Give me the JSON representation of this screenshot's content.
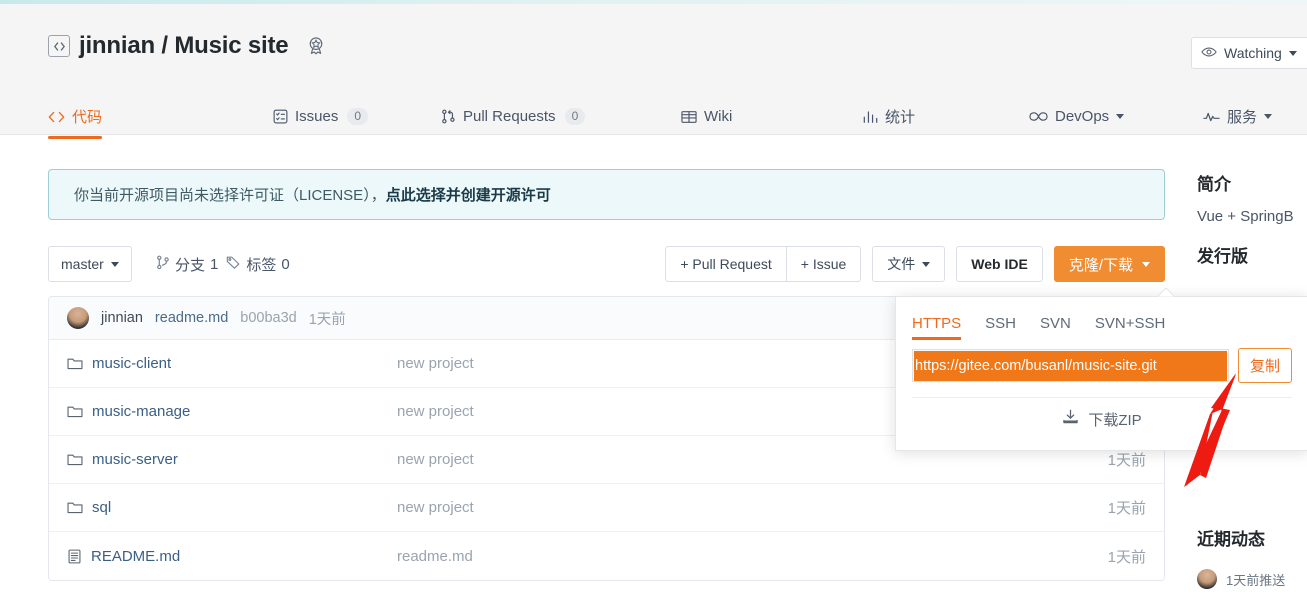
{
  "header": {
    "owner": "jinnian",
    "separator": "/",
    "repo": "Music site",
    "repo_icon": "code-repo-icon",
    "badge_icon": "award-badge-icon",
    "watching": {
      "label": "Watching",
      "icon": "eye-icon"
    }
  },
  "nav": {
    "tabs": [
      {
        "label": "代码",
        "icon": "code-icon",
        "count": null,
        "active": true
      },
      {
        "label": "Issues",
        "icon": "issues-icon",
        "count": "0",
        "active": false
      },
      {
        "label": "Pull Requests",
        "icon": "pull-request-icon",
        "count": "0",
        "active": false
      },
      {
        "label": "Wiki",
        "icon": "wiki-book-icon",
        "count": null,
        "active": false
      },
      {
        "label": "统计",
        "icon": "chart-bar-icon",
        "count": null,
        "active": false
      },
      {
        "label": "DevOps",
        "icon": "infinity-icon",
        "count": null,
        "active": false,
        "dropdown": true
      },
      {
        "label": "服务",
        "icon": "pulse-icon",
        "count": null,
        "active": false,
        "dropdown": true
      }
    ]
  },
  "license_banner": {
    "text": "你当前开源项目尚未选择许可证（LICENSE），",
    "link": "点此选择并创建开源许可"
  },
  "toolbar": {
    "branch": "master",
    "branches_label": "分支",
    "branches_count": "1",
    "tags_label": "标签",
    "tags_count": "0",
    "pull_request": "+ Pull Request",
    "issue": "+ Issue",
    "file_menu": "文件",
    "web_ide": "Web IDE",
    "clone_download": "克隆/下载"
  },
  "commit_header": {
    "author": "jinnian",
    "message": "readme.md",
    "sha": "b00ba3d",
    "time": "1天前"
  },
  "files": [
    {
      "name": "music-client",
      "type": "folder",
      "commit": "new project",
      "time": ""
    },
    {
      "name": "music-manage",
      "type": "folder",
      "commit": "new project",
      "time": ""
    },
    {
      "name": "music-server",
      "type": "folder",
      "commit": "new project",
      "time": "1天前"
    },
    {
      "name": "sql",
      "type": "folder",
      "commit": "new project",
      "time": "1天前"
    },
    {
      "name": "README.md",
      "type": "file",
      "commit": "readme.md",
      "time": "1天前"
    }
  ],
  "clone_popover": {
    "tabs": [
      "HTTPS",
      "SSH",
      "SVN",
      "SVN+SSH"
    ],
    "active_tab": "HTTPS",
    "url": "https://gitee.com/busanl/music-site.git",
    "copy_label": "复制",
    "download_zip": "下载ZIP",
    "download_icon": "download-icon"
  },
  "sidebar": {
    "intro_heading": "简介",
    "intro_text": "Vue + SpringB",
    "release_heading": "发行版",
    "recent_heading": "近期动态",
    "recent_item": "1天前推送"
  },
  "colors": {
    "accent_orange": "#ec6b1e",
    "clone_button": "#f08c32",
    "selection_orange": "#f07818",
    "banner_bg": "#ecf8f9",
    "banner_border": "#9ecfd4",
    "link_blue": "#3a5f86",
    "arrow_red": "#ee1b13"
  }
}
